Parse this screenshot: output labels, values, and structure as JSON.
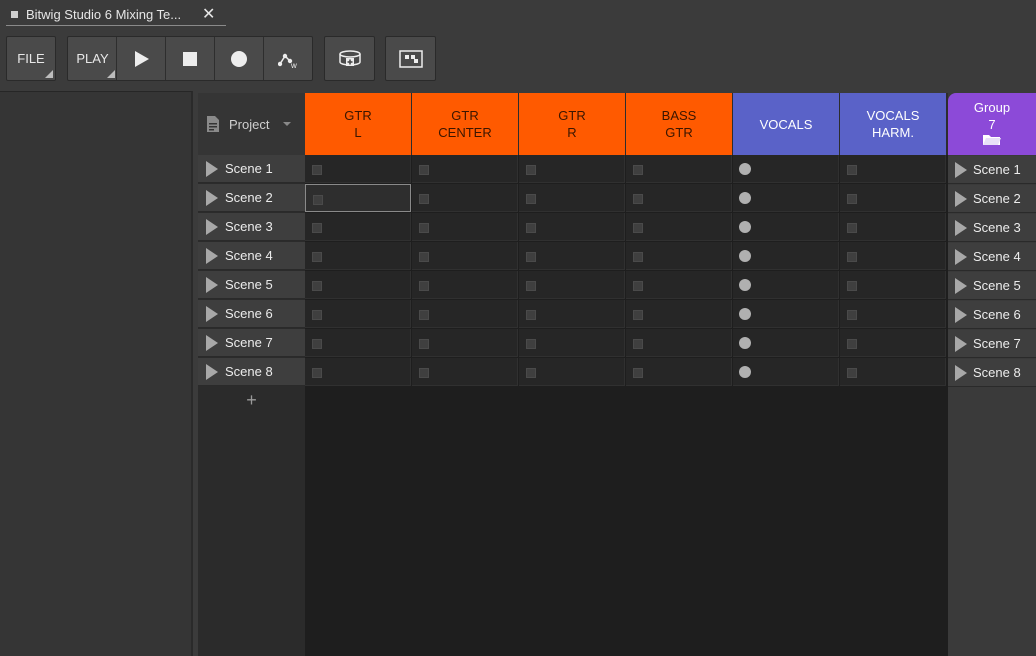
{
  "window": {
    "tab_title": "Bitwig Studio 6 Mixing Te...",
    "close_glyph": "✕"
  },
  "toolbar": {
    "file_label": "FILE",
    "play_label": "PLAY",
    "icons": [
      "play-icon",
      "stop-icon",
      "record-icon",
      "automation-write-icon",
      "add-device-icon",
      "grid-view-icon"
    ]
  },
  "launcher": {
    "project_label": "Project",
    "add_scene_glyph": "+",
    "tracks": [
      {
        "line1": "GTR",
        "line2": "L",
        "color": "#ff5a00"
      },
      {
        "line1": "GTR",
        "line2": "CENTER",
        "color": "#ff5a00"
      },
      {
        "line1": "GTR",
        "line2": "R",
        "color": "#ff5a00"
      },
      {
        "line1": "BASS",
        "line2": "GTR",
        "color": "#ff5a00"
      },
      {
        "line1": "VOCALS",
        "line2": "",
        "color": "#5a62c8"
      },
      {
        "line1": "VOCALS",
        "line2": "HARM.",
        "color": "#5a62c8"
      }
    ],
    "group": {
      "line1": "Group",
      "line2": "7",
      "color": "#8c4ad8"
    },
    "scenes": [
      "Scene 1",
      "Scene 2",
      "Scene 3",
      "Scene 4",
      "Scene 5",
      "Scene 6",
      "Scene 7",
      "Scene 8"
    ],
    "selected_slot": {
      "scene": 2,
      "track": "GTR L"
    }
  },
  "colors": {
    "guitar_tracks": "#ff5a00",
    "vocal_tracks": "#5a62c8",
    "group_track": "#8c4ad8"
  }
}
